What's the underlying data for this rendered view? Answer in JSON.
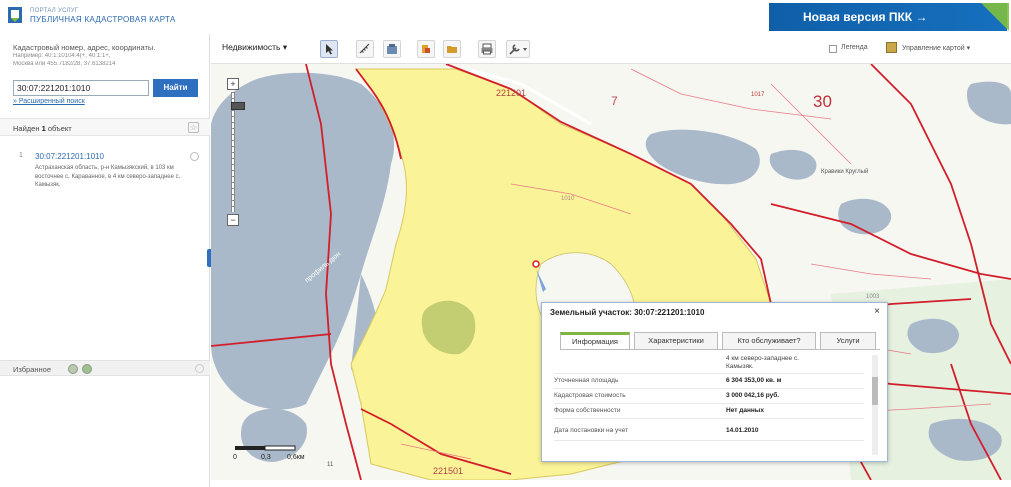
{
  "header": {
    "portal": "ПОРТАЛ УСЛУГ",
    "title": "ПУБЛИЧНАЯ КАДАСТРОВАЯ КАРТА",
    "new_version": "Новая версия ПКК →"
  },
  "sidebar": {
    "search_hint": "Кадастровый номер, адрес, координаты.",
    "hint_example1": "Например: 40:1:10104:4(+, 40:1:1+,",
    "hint_example2": "Москва или 455.7182/28, 37.6138214",
    "search_value": "30:07:221201:1010",
    "find_button": "Найти",
    "advanced_search": "» Расширенный поиск",
    "found_prefix": "Найден",
    "found_count": "1",
    "found_suffix": "объект",
    "result": {
      "number": "1",
      "cadastral": "30:07:221201:1010",
      "address": "Астраханская область, р-н Камызякский, в 103 км восточнее с. Караванное, в 4 км северо-западнее с. Камызяк."
    },
    "favorites": "Избранное"
  },
  "toolbar": {
    "layer_select": "Недвижимость ▾",
    "legend": "Легенда",
    "map_management": "Управление картой ▾"
  },
  "map": {
    "labels": {
      "block_top": "221201",
      "block_bottom": "221501",
      "num_7": "7",
      "num_30": "30",
      "num_1017": "1017",
      "num_1010": "1010",
      "num_1003": "1003",
      "place": "Кравики Круглый",
      "road": "профиль дюн",
      "num_11": "11"
    },
    "scale": {
      "zero": "0",
      "mid": "0,3",
      "end": "0,6км"
    },
    "zoom": {
      "plus": "+",
      "minus": "−"
    }
  },
  "popup": {
    "title": "Земельный участок: 30:07:221201:1010",
    "close": "×",
    "tabs": [
      "Информация",
      "Характеристики",
      "Кто обслуживает?",
      "Услуги"
    ],
    "partial_text_1": "4 км северо-западнее с.",
    "partial_text_2": "Камызяк.",
    "rows": [
      {
        "label": "Уточненная площадь",
        "value": "6 304 353,00 кв. м"
      },
      {
        "label": "Кадастровая стоимость",
        "value": "3 000 042,16 руб."
      },
      {
        "label": "Форма собственности",
        "value": "Нет данных"
      },
      {
        "label": "Дата постановки на учет",
        "value": "14.01.2010"
      }
    ]
  },
  "colors": {
    "parcel_fill": "#fbf397",
    "water": "#a9b9c9",
    "boundary": "#d21e2a",
    "accent": "#2f6fc0"
  }
}
